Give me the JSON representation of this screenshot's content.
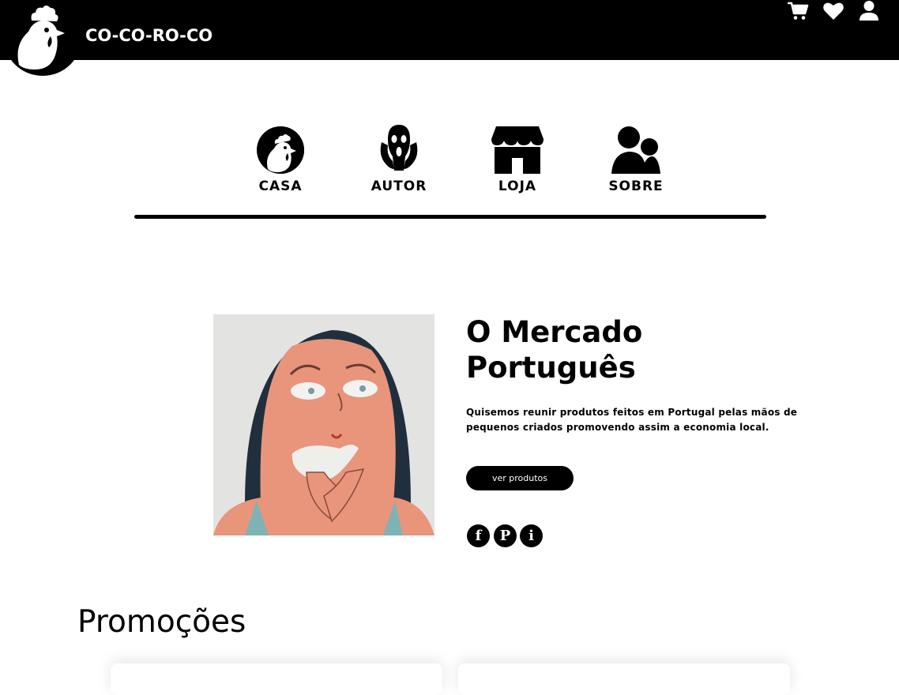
{
  "brand": {
    "name": "CO-CO-RO-CO"
  },
  "top_icons": [
    {
      "name": "cart-icon"
    },
    {
      "name": "heart-icon"
    },
    {
      "name": "user-icon"
    }
  ],
  "nav": {
    "items": [
      {
        "label": "CASA",
        "icon": "rooster-circle-icon"
      },
      {
        "label": "AUTOR",
        "icon": "scream-face-icon"
      },
      {
        "label": "LOJA",
        "icon": "storefront-icon"
      },
      {
        "label": "SOBRE",
        "icon": "people-icon"
      }
    ]
  },
  "hero": {
    "title": "O Mercado Português",
    "description": "Quisemos reunir produtos feitos em Portugal pelas mãos de pequenos criados promovendo assim a economia local.",
    "button_label": "ver produtos",
    "social": [
      {
        "icon": "facebook-icon",
        "glyph": "f"
      },
      {
        "icon": "pinterest-icon",
        "glyph": "P"
      },
      {
        "icon": "info-icon",
        "glyph": "i"
      }
    ]
  },
  "promotions": {
    "title": "Promoções"
  },
  "colors": {
    "header_bg": "#000000",
    "skin": "#e8957c",
    "hair": "#1f2f3d",
    "background": "#ffffff"
  }
}
